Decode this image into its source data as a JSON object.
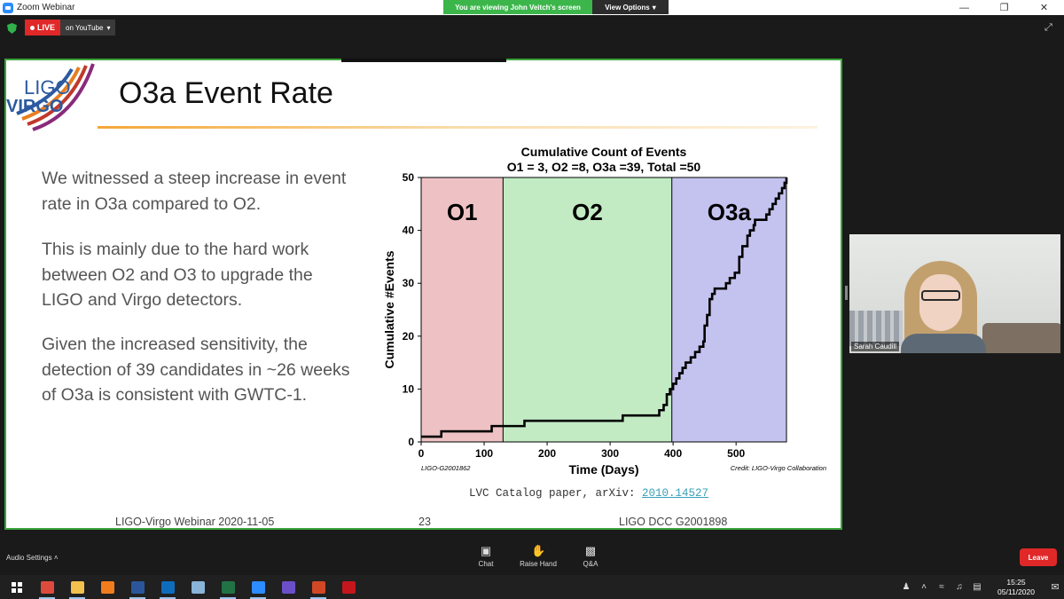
{
  "window": {
    "title": "Zoom Webinar"
  },
  "share_banner": {
    "viewing_text": "You are viewing John Veitch's screen",
    "view_options_label": "View Options"
  },
  "live": {
    "label": "LIVE",
    "platform": "on YouTube"
  },
  "slide": {
    "logo_text_top": "LIGO",
    "logo_text_bottom": "VIRGO",
    "title": "O3a Event Rate",
    "paragraphs": [
      "We witnessed a steep increase in event rate in O3a compared to O2.",
      "This is mainly due to the hard work between O2 and O3 to upgrade the LIGO and Virgo detectors.",
      "Given the increased sensitivity, the detection of 39 candidates in ~26 weeks of O3a is consistent with GWTC-1."
    ],
    "citation_prefix": "LVC Catalog paper, arXiv: ",
    "citation_link": "2010.14527",
    "footer_left": "LIGO-Virgo Webinar 2020-11-05",
    "footer_center": "23",
    "footer_right": "LIGO DCC G2001898"
  },
  "chart_data": {
    "type": "line",
    "title": "Cumulative Count of Events",
    "subtitle": "O1 = 3, O2 =8, O3a =39, Total =50",
    "xlabel": "Time (Days)",
    "ylabel": "Cumulative #Events",
    "xlim": [
      0,
      580
    ],
    "ylim": [
      0,
      50
    ],
    "xticks": [
      0,
      100,
      200,
      300,
      400,
      500
    ],
    "yticks": [
      0,
      10,
      20,
      30,
      40,
      50
    ],
    "grid": false,
    "regions": [
      {
        "label": "O1",
        "x0": 0,
        "x1": 130,
        "color": "#eec2c4"
      },
      {
        "label": "O2",
        "x0": 130,
        "x1": 398,
        "color": "#c2ebc4"
      },
      {
        "label": "O3a",
        "x0": 398,
        "x1": 580,
        "color": "#c4c3ef"
      }
    ],
    "series": [
      {
        "values_xy": [
          [
            0,
            1
          ],
          [
            20,
            1
          ],
          [
            32,
            2
          ],
          [
            110,
            2
          ],
          [
            112,
            3
          ],
          [
            160,
            3
          ],
          [
            164,
            4
          ],
          [
            318,
            4
          ],
          [
            320,
            5
          ],
          [
            375,
            5
          ],
          [
            378,
            6
          ],
          [
            385,
            7
          ],
          [
            390,
            9
          ],
          [
            395,
            10
          ],
          [
            400,
            11
          ],
          [
            405,
            12
          ],
          [
            410,
            13
          ],
          [
            415,
            14
          ],
          [
            420,
            15
          ],
          [
            428,
            16
          ],
          [
            435,
            17
          ],
          [
            442,
            18
          ],
          [
            448,
            19
          ],
          [
            450,
            22
          ],
          [
            454,
            24
          ],
          [
            458,
            27
          ],
          [
            462,
            28
          ],
          [
            466,
            29
          ],
          [
            480,
            29
          ],
          [
            484,
            30
          ],
          [
            490,
            31
          ],
          [
            498,
            32
          ],
          [
            505,
            35
          ],
          [
            510,
            37
          ],
          [
            518,
            39
          ],
          [
            522,
            40
          ],
          [
            528,
            41
          ],
          [
            530,
            42
          ],
          [
            546,
            42
          ],
          [
            548,
            43
          ],
          [
            553,
            44
          ],
          [
            558,
            45
          ],
          [
            563,
            46
          ],
          [
            568,
            47
          ],
          [
            573,
            48
          ],
          [
            577,
            49
          ],
          [
            580,
            50
          ]
        ],
        "color": "#000000"
      }
    ],
    "annotations": [
      "LIGO-G2001862",
      "Credit: LIGO-Virgo Collaboration"
    ]
  },
  "video": {
    "participant_name": "Sarah Caudill"
  },
  "toolbar": {
    "audio_settings": "Audio Settings",
    "chat": "Chat",
    "raise_hand": "Raise Hand",
    "qa": "Q&A",
    "leave": "Leave"
  },
  "taskbar": {
    "time": "15:25",
    "date": "05/11/2020",
    "apps": [
      {
        "name": "chrome",
        "color": "#dd4b3e"
      },
      {
        "name": "file-explorer",
        "color": "#f2c14e"
      },
      {
        "name": "search-app",
        "color": "#f07c1e"
      },
      {
        "name": "word",
        "color": "#2b579a"
      },
      {
        "name": "outlook",
        "color": "#0f6cbd"
      },
      {
        "name": "notes",
        "color": "#8ab4d8"
      },
      {
        "name": "excel",
        "color": "#217346"
      },
      {
        "name": "zoom",
        "color": "#2d8cff"
      },
      {
        "name": "drop-app",
        "color": "#6a4fc9"
      },
      {
        "name": "powerpoint",
        "color": "#d24726"
      },
      {
        "name": "acrobat",
        "color": "#c4161c"
      }
    ]
  }
}
